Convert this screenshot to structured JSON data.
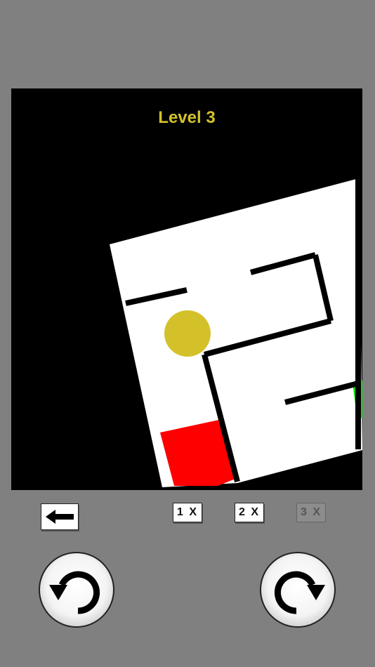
{
  "level": {
    "title": "Level 3"
  },
  "icons": {
    "back": "arrow-left-icon",
    "rotate_left": "rotate-counterclockwise-icon",
    "rotate_right": "rotate-clockwise-icon"
  },
  "controls": {
    "speed_1x": "1 X",
    "speed_2x": "2 X",
    "speed_3x": "3 X",
    "speed_3x_enabled": false
  },
  "colors": {
    "background": "#808080",
    "board": "#000000",
    "maze_floor": "#ffffff",
    "ball": "#d4c12a",
    "start_zone": "#ff0000",
    "exit_zone": "#00ff00",
    "title": "#d4c12a"
  }
}
